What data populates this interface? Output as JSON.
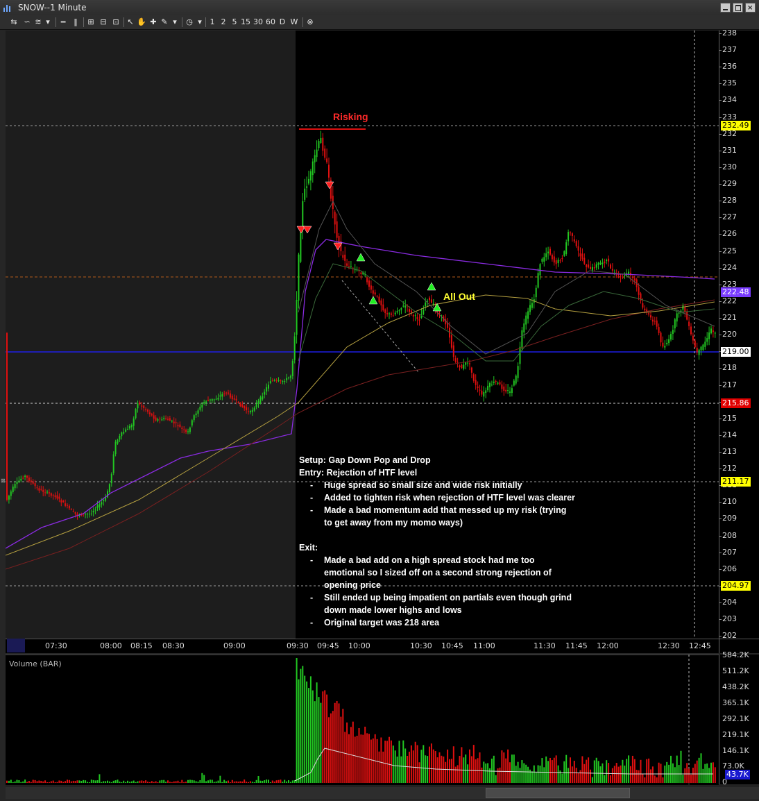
{
  "window": {
    "title": "SNOW--1 Minute",
    "buttons": [
      "minimize",
      "maximize",
      "close"
    ]
  },
  "toolbar": {
    "intervals": [
      "1",
      "2",
      "5",
      "15",
      "30",
      "60",
      "D",
      "W"
    ]
  },
  "price_axis": {
    "ticks": [
      "238",
      "237",
      "236",
      "235",
      "234",
      "233",
      "232",
      "231",
      "230",
      "229",
      "228",
      "227",
      "226",
      "225",
      "224",
      "223",
      "222",
      "221",
      "220",
      "219",
      "218",
      "217",
      "216",
      "215",
      "214",
      "213",
      "212",
      "211",
      "210",
      "209",
      "208",
      "207",
      "206",
      "205",
      "204",
      "203",
      "202"
    ],
    "labels": [
      {
        "text": "232.49",
        "bg": "#ffff00",
        "fg": "#000000"
      },
      {
        "text": "222.48",
        "bg": "#7a3cff",
        "fg": "#ffffff"
      },
      {
        "text": "219.00",
        "bg": "#ffffff",
        "fg": "#000000"
      },
      {
        "text": "215.86",
        "bg": "#e00000",
        "fg": "#ffffff"
      },
      {
        "text": "211.17",
        "bg": "#ffff00",
        "fg": "#000000"
      },
      {
        "text": "204.97",
        "bg": "#ffff00",
        "fg": "#000000"
      }
    ]
  },
  "time_axis": [
    "3/ 3",
    "07:30",
    "08:00",
    "08:15",
    "08:30",
    "09:00",
    "09:30",
    "09:45",
    "10:00",
    "10:30",
    "10:45",
    "11:00",
    "11:30",
    "11:45",
    "12:00",
    "12:30",
    "12:45"
  ],
  "annotations": {
    "risking": "Risking",
    "all_out": "All Out"
  },
  "notes": {
    "setup": "Setup: Gap Down Pop and Drop",
    "entry": "Entry: Rejection of HTF level",
    "entry_items": [
      "Huge spread so small size and wide risk initially",
      "Added to tighten risk when rejection of HTF level was clearer",
      "Made a bad momentum add that messed up my risk (trying",
      "to get away from my momo ways)"
    ],
    "exit": "Exit:",
    "exit_items": [
      "Made a bad add on a high spread stock had me too",
      "emotional so I sized off on a second strong rejection of",
      "opening price",
      "Still ended up being impatient on partials even though grind",
      "down made lower highs and lows",
      "Original target was 218 area"
    ],
    "bullet": "-"
  },
  "volume": {
    "title": "Volume (BAR)",
    "ticks": [
      "584.2K",
      "511.2K",
      "438.2K",
      "365.1K",
      "292.1K",
      "219.1K",
      "146.1K",
      "73.0K",
      "0"
    ],
    "current_label": "43.7K"
  },
  "colors": {
    "up": "#22c722",
    "down": "#e01010",
    "vwap": "#8a2be2",
    "blue_level": "#1e1ee6"
  }
}
